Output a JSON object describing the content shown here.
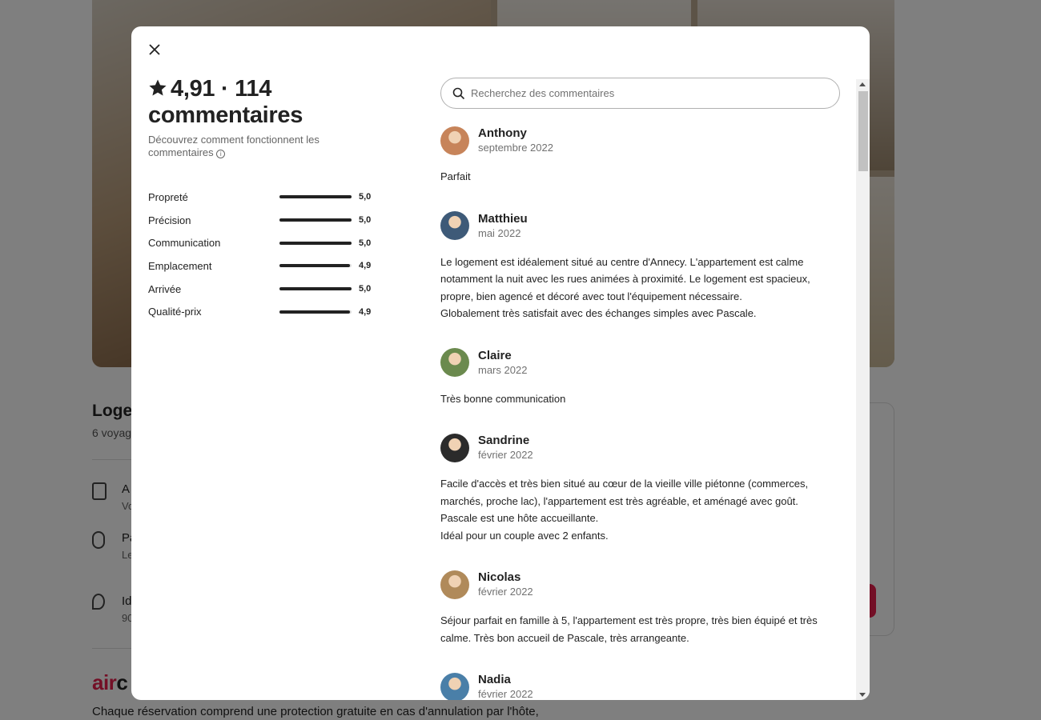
{
  "background": {
    "listing_title": "Loge",
    "listing_subtitle": "6 voyag",
    "features": [
      {
        "title": "A",
        "sub": "Vo"
      },
      {
        "title": "Pa",
        "sub": "Le"
      },
      {
        "title": "Id",
        "sub": "90"
      }
    ],
    "aircover_a": "air",
    "aircover_b": "c",
    "footer_text": "Chaque réservation comprend une protection gratuite en cas d'annulation par l'hôte,"
  },
  "modal": {
    "close_icon": "close-icon",
    "rating": "4,91",
    "separator": "·",
    "review_count_label": "114 commentaires",
    "how_reviews_work": "Découvrez comment fonctionnent les commentaires",
    "info_glyph": "i",
    "categories": [
      {
        "label": "Propreté",
        "value": "5,0",
        "score": 5.0
      },
      {
        "label": "Précision",
        "value": "5,0",
        "score": 5.0
      },
      {
        "label": "Communication",
        "value": "5,0",
        "score": 5.0
      },
      {
        "label": "Emplacement",
        "value": "4,9",
        "score": 4.9
      },
      {
        "label": "Arrivée",
        "value": "5,0",
        "score": 5.0
      },
      {
        "label": "Qualité-prix",
        "value": "4,9",
        "score": 4.9
      }
    ],
    "search": {
      "placeholder": "Recherchez des commentaires",
      "value": "",
      "icon": "search-icon"
    },
    "reviews": [
      {
        "name": "Anthony",
        "date": "septembre 2022",
        "text": "Parfait",
        "avatar_color": "#c7845a"
      },
      {
        "name": "Matthieu",
        "date": "mai 2022",
        "text": "Le logement est idéalement situé au centre d'Annecy. L'appartement est calme notamment la nuit avec les rues animées à proximité. Le logement est spacieux, propre, bien agencé et décoré avec tout l'équipement nécessaire.\nGlobalement très satisfait avec des échanges simples avec Pascale.",
        "avatar_color": "#3e5a78"
      },
      {
        "name": "Claire",
        "date": "mars 2022",
        "text": "Très bonne communication",
        "avatar_color": "#6b8a4e"
      },
      {
        "name": "Sandrine",
        "date": "février 2022",
        "text": "Facile d'accès et très bien situé au cœur de la vieille ville piétonne (commerces, marchés, proche lac), l'appartement est très agréable, et aménagé avec goût.\nPascale est une hôte accueillante.\nIdéal pour un couple avec 2 enfants.",
        "avatar_color": "#2b2b2b"
      },
      {
        "name": "Nicolas",
        "date": "février 2022",
        "text": "Séjour parfait en famille à 5, l'appartement est très propre, très bien équipé et très calme. Très bon accueil de Pascale, très arrangeante.",
        "avatar_color": "#b08a5a"
      },
      {
        "name": "Nadia",
        "date": "février 2022",
        "text": "",
        "avatar_color": "#4a7fa8"
      }
    ]
  }
}
